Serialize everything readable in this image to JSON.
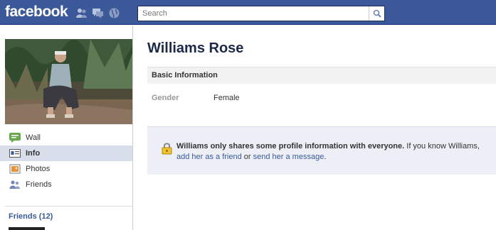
{
  "topbar": {
    "logo": "facebook",
    "jewels": [
      "friend-requests-icon",
      "messages-icon",
      "notifications-globe-icon"
    ],
    "search": {
      "placeholder": "Search",
      "value": ""
    },
    "colors": {
      "bar": "#3b5998"
    }
  },
  "sidebar": {
    "items": [
      {
        "label": "Wall",
        "icon": "wall-icon"
      },
      {
        "label": "Info",
        "icon": "info-icon",
        "active": true
      },
      {
        "label": "Photos",
        "icon": "photos-icon"
      },
      {
        "label": "Friends",
        "icon": "friends-icon"
      }
    ],
    "friends_header": "Friends (12)"
  },
  "profile": {
    "name": "Williams Rose",
    "section_title": "Basic Information",
    "gender_label": "Gender",
    "gender_value": "Female"
  },
  "notice": {
    "bold": "Williams only shares some profile information with everyone.",
    "plain": " If you know Williams,",
    "link_friend": "add her as a friend",
    "or": " or ",
    "link_message": "send her a message",
    "end": "."
  }
}
